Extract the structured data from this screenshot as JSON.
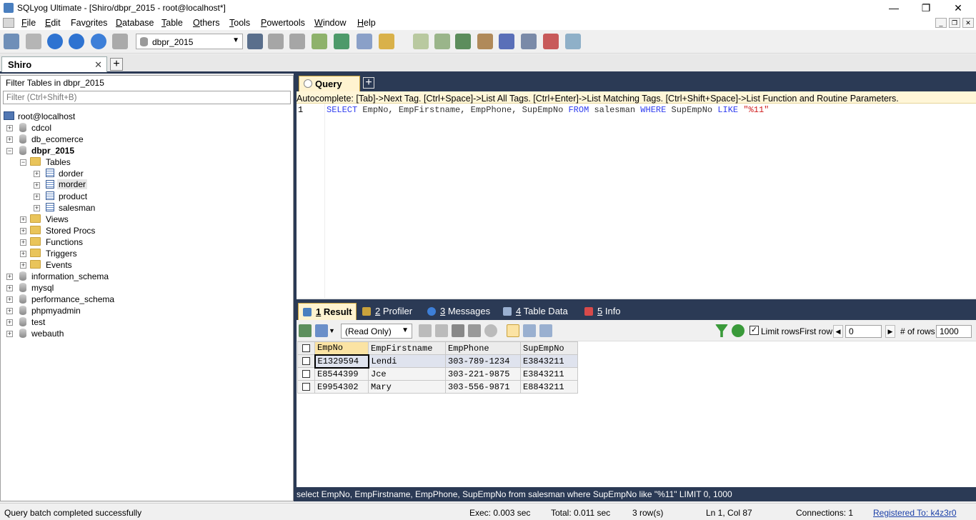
{
  "window": {
    "title": "SQLyog Ultimate - [Shiro/dbpr_2015 - root@localhost*]",
    "min": "—",
    "max": "❐",
    "close": "✕"
  },
  "menu": {
    "items": [
      {
        "accel": "F",
        "rest": "ile"
      },
      {
        "accel": "E",
        "rest": "dit"
      },
      {
        "accel": "",
        "rest": "Favorites",
        "pre": "Fav",
        "u": "o",
        "post": "rites"
      },
      {
        "accel": "D",
        "rest": "atabase"
      },
      {
        "accel": "T",
        "rest": "able"
      },
      {
        "accel": "O",
        "rest": "thers"
      },
      {
        "accel": "T",
        "rest": "ools"
      },
      {
        "accel": "P",
        "rest": "owertools"
      },
      {
        "accel": "W",
        "rest": "indow"
      },
      {
        "accel": "H",
        "rest": "elp"
      }
    ]
  },
  "toolbar": {
    "db_selector": "dbpr_2015"
  },
  "connection_tab": {
    "label": "Shiro",
    "close": "✕",
    "add": "+"
  },
  "object_browser": {
    "filter_label": "Filter Tables in dbpr_2015",
    "filter_placeholder": "Filter (Ctrl+Shift+B)",
    "root": "root@localhost",
    "databases": [
      "cdcol",
      "db_ecomerce",
      "dbpr_2015",
      "information_schema",
      "mysql",
      "performance_schema",
      "phpmyadmin",
      "test",
      "webauth"
    ],
    "folders": [
      "Tables",
      "Views",
      "Stored Procs",
      "Functions",
      "Triggers",
      "Events"
    ],
    "tables": [
      "dorder",
      "morder",
      "product",
      "salesman"
    ]
  },
  "query_tab": {
    "label": "Query",
    "add": "+"
  },
  "autocomplete_hint": "Autocomplete: [Tab]->Next Tag. [Ctrl+Space]->List All Tags. [Ctrl+Enter]->List Matching Tags. [Ctrl+Shift+Space]->List Function and Routine Parameters.",
  "editor": {
    "line_number": "1",
    "sql": {
      "kw1": "SELECT",
      "cols": " EmpNo, EmpFirstname, EmpPhone, SupEmpNo ",
      "kw2": "FROM",
      "tbl": " salesman ",
      "kw3": "WHERE",
      "col": " SupEmpNo ",
      "kw4": "LIKE",
      "space": " ",
      "str": "\"%11\""
    }
  },
  "result_tabs": [
    {
      "num": "1",
      "label": " Result"
    },
    {
      "num": "2",
      "label": " Profiler"
    },
    {
      "num": "3",
      "label": " Messages"
    },
    {
      "num": "4",
      "label": " Table Data"
    },
    {
      "num": "5",
      "label": " Info"
    }
  ],
  "result_toolbar": {
    "mode": "(Read Only)",
    "limit_rows_label": "Limit rows",
    "limit_checked": "✓",
    "first_row_label": "First row",
    "first_row_value": "0",
    "num_rows_label": "# of rows",
    "num_rows_value": "1000"
  },
  "grid": {
    "columns": [
      "EmpNo",
      "EmpFirstname",
      "EmpPhone",
      "SupEmpNo"
    ],
    "rows": [
      [
        "E1329594",
        "Lendi",
        "303-789-1234",
        "E3843211"
      ],
      [
        "E8544399",
        "Jce",
        "303-221-9875",
        "E3843211"
      ],
      [
        "E9954302",
        "Mary",
        "303-556-9871",
        "E8843211"
      ]
    ]
  },
  "query_status": "select EmpNo, EmpFirstname, EmpPhone, SupEmpNo from salesman where SupEmpNo like \"%11\" LIMIT 0, 1000",
  "statusbar": {
    "message": "Query batch completed successfully",
    "exec": "Exec: 0.003 sec",
    "total": "Total: 0.011 sec",
    "rows": "3 row(s)",
    "pos": "Ln 1, Col 87",
    "connections": "Connections: 1",
    "registered": "Registered To: k4z3r0"
  },
  "colors": {
    "panel_dark": "#2b3a55",
    "tab_active": "#fff3d0",
    "keyword": "#2f3df0",
    "string": "#d02020"
  }
}
